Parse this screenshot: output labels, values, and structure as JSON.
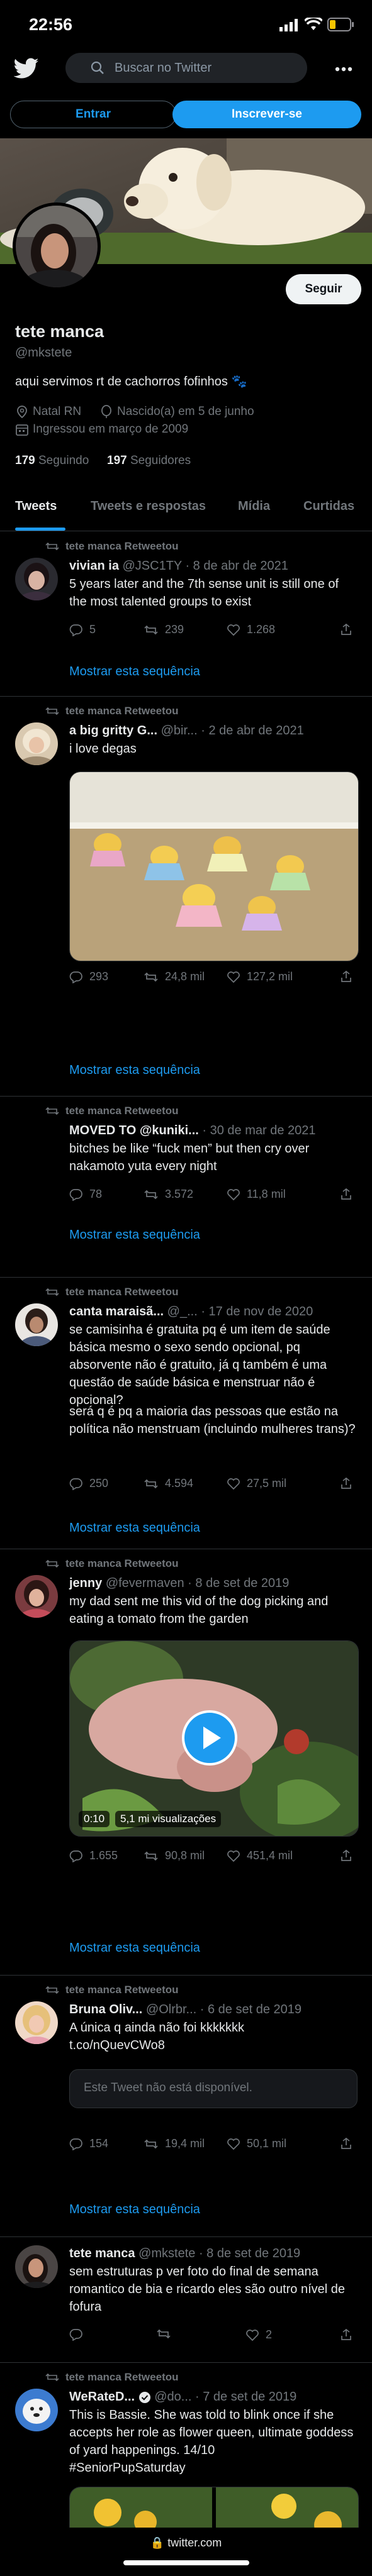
{
  "status_bar": {
    "time": "22:56"
  },
  "header": {
    "search_placeholder": "Buscar no Twitter"
  },
  "auth": {
    "login_label": "Entrar",
    "signup_label": "Inscrever-se"
  },
  "profile": {
    "follow_label": "Seguir",
    "name": "tete manca",
    "handle": "@mkstete",
    "bio": "aqui servimos rt de cachorros fofinhos",
    "location": "Natal RN",
    "birthday": "Nascido(a) em 5 de junho",
    "joined": "Ingressou em março de 2009",
    "following_count": "179",
    "following_label": "Seguindo",
    "followers_count": "197",
    "followers_label": "Seguidores"
  },
  "tabs": [
    "Tweets",
    "Tweets e respostas",
    "Mídia",
    "Curtidas"
  ],
  "colors": {
    "accent": "#1d9bf0",
    "background": "#000000",
    "muted": "#71767b"
  },
  "tweets": [
    {
      "retweet_label": "tete manca Retweetou",
      "name": "vivian ia",
      "handle": "@JSC1TY",
      "date": "· 8 de abr de 2021",
      "text": "5 years later and the 7th sense unit is still one of the most talented groups to exist",
      "replies": "5",
      "retweets": "239",
      "likes": "1.268",
      "show_thread": "Mostrar esta sequência"
    },
    {
      "retweet_label": "tete manca Retweetou",
      "name": "a big gritty G...",
      "handle": "@bir...",
      "date": "· 2 de abr de 2021",
      "text": "i love degas",
      "replies": "293",
      "retweets": "24,8 mil",
      "likes": "127,2 mil",
      "show_thread": "Mostrar esta sequência"
    },
    {
      "retweet_label": "tete manca Retweetou",
      "name": "MOVED TO @kuniki...",
      "handle": "",
      "date": "· 30 de mar de 2021",
      "text": "bitches be like “fuck men” but then cry over nakamoto yuta every night",
      "replies": "78",
      "retweets": "3.572",
      "likes": "11,8 mil",
      "show_thread": "Mostrar esta sequência"
    },
    {
      "retweet_label": "tete manca Retweetou",
      "name": "canta maraisã...",
      "handle": "@_...",
      "date": "· 17 de nov de 2020",
      "text": "se camisinha é gratuita pq é um item de saúde básica mesmo o sexo sendo opcional, pq absorvente não é gratuito, já q também é uma questão de saúde básica e menstruar não é opcional?",
      "text2": "será q é pq a maioria das pessoas que estão na política não menstruam (incluindo mulheres trans)?",
      "replies": "250",
      "retweets": "4.594",
      "likes": "27,5 mil",
      "show_thread": "Mostrar esta sequência"
    },
    {
      "retweet_label": "tete manca Retweetou",
      "name": "jenny",
      "handle": "@fevermaven",
      "date": "· 8 de set de 2019",
      "text": "my dad sent me this vid of the dog picking and eating a tomato from the garden",
      "video_time": "0:10",
      "video_views": "5,1 mi visualizações",
      "replies": "1.655",
      "retweets": "90,8 mil",
      "likes": "451,4 mil",
      "show_thread": "Mostrar esta sequência"
    },
    {
      "retweet_label": "tete manca Retweetou",
      "name": "Bruna Oliv...",
      "handle": "@Olrbr...",
      "date": "· 6 de set de 2019",
      "text": "A única q ainda não foi kkkkkkk",
      "link": "t.co/nQuevCWo8",
      "unavailable": "Este Tweet não está disponível.",
      "replies": "154",
      "retweets": "19,4 mil",
      "likes": "50,1 mil",
      "show_thread": "Mostrar esta sequência"
    },
    {
      "retweet_label": "",
      "name": "tete manca",
      "handle": "@mkstete",
      "date": "· 8 de set de 2019",
      "text": "sem estruturas p ver foto do final de semana romantico de bia e ricardo eles são outro nível de fofura",
      "replies": "",
      "retweets": "",
      "likes": "2",
      "show_thread": ""
    },
    {
      "retweet_label": "tete manca Retweetou",
      "name": "WeRateD...",
      "handle": "@do...",
      "date": "· 7 de set de 2019",
      "text": "This is Bassie. She was told to blink once if she accepts her role as flower queen, ultimate goddess of yard happenings. 14/10",
      "hashtag": "#SeniorPupSaturday",
      "replies": "",
      "retweets": "",
      "likes": "",
      "show_thread": ""
    }
  ],
  "browser": {
    "url": "twitter.com"
  }
}
